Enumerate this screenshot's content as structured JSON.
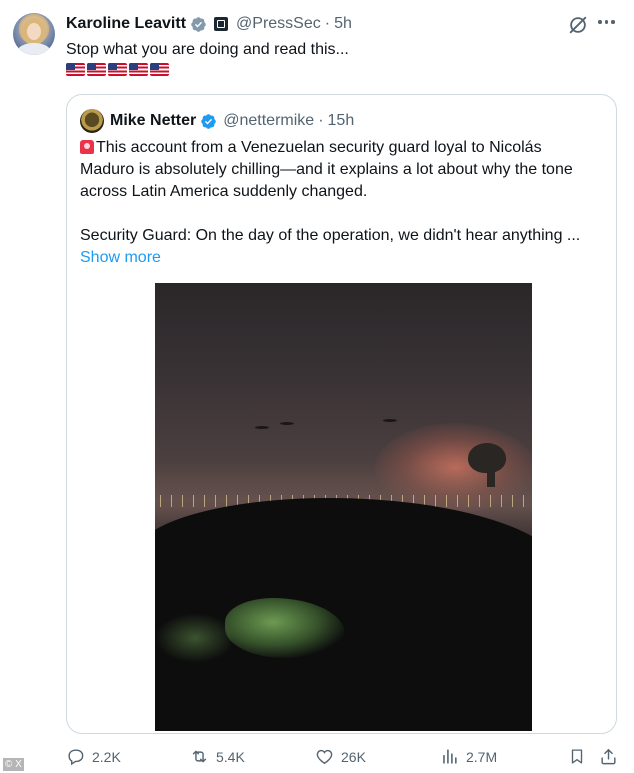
{
  "tweet": {
    "author_name": "Karoline Leavitt",
    "handle": "@PressSec",
    "separator": "·",
    "time": "5h",
    "text": "Stop what you are doing and read this...",
    "flags": [
      "us-flag",
      "us-flag",
      "us-flag",
      "us-flag",
      "us-flag"
    ]
  },
  "quote": {
    "author_name": "Mike Netter",
    "handle": "@nettermike",
    "separator": "·",
    "time": "15h",
    "lines": [
      "This account from a Venezuelan security guard loyal to Nicolás",
      "Maduro is absolutely chilling—and it explains a lot about why the tone",
      "across Latin America suddenly changed."
    ],
    "line4": "Security Guard: On the day of the operation, we didn't hear anything ...",
    "show_more": "Show more"
  },
  "actions": {
    "replies": "2.2K",
    "reposts": "5.4K",
    "likes": "26K",
    "views": "2.7M"
  },
  "watermark": "© X",
  "colors": {
    "text": "#0f1419",
    "secondary": "#536471",
    "link": "#1d9bf0",
    "border": "#cfd9de",
    "verified_blue": "#1d9bf0",
    "verified_grey": "#829aab"
  },
  "icons": {
    "siren": "police-light-icon",
    "grok": "grok-icon",
    "more": "more-options-icon"
  }
}
